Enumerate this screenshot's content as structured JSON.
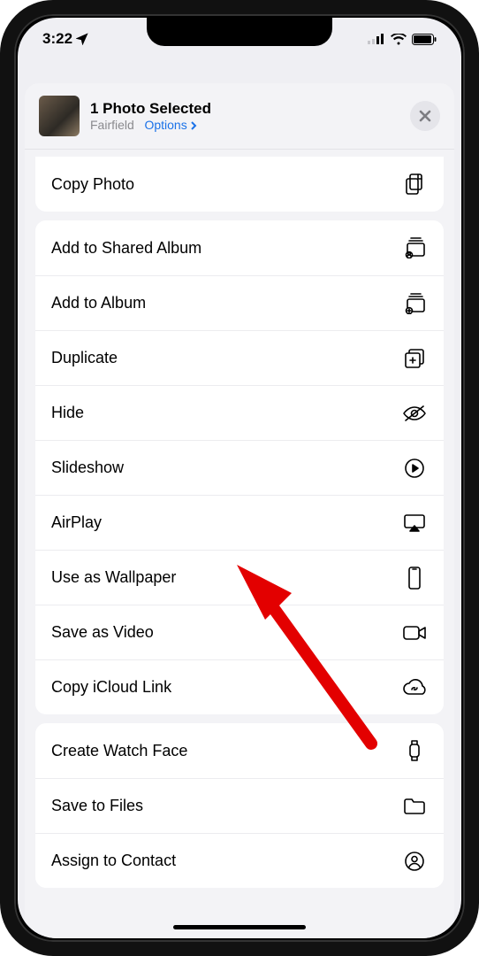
{
  "status": {
    "time": "3:22"
  },
  "header": {
    "title": "1 Photo Selected",
    "location": "Fairfield",
    "options_label": "Options"
  },
  "groups": [
    {
      "rows": [
        {
          "name": "copy-photo",
          "label": "Copy Photo",
          "icon": "doc-on-doc"
        }
      ]
    },
    {
      "rows": [
        {
          "name": "add-shared-album",
          "label": "Add to Shared Album",
          "icon": "shared-album"
        },
        {
          "name": "add-album",
          "label": "Add to Album",
          "icon": "add-album"
        },
        {
          "name": "duplicate",
          "label": "Duplicate",
          "icon": "plus-square-on-square"
        },
        {
          "name": "hide",
          "label": "Hide",
          "icon": "eye-slash"
        },
        {
          "name": "slideshow",
          "label": "Slideshow",
          "icon": "play-circle"
        },
        {
          "name": "airplay",
          "label": "AirPlay",
          "icon": "airplay"
        },
        {
          "name": "use-wallpaper",
          "label": "Use as Wallpaper",
          "icon": "iphone"
        },
        {
          "name": "save-video",
          "label": "Save as Video",
          "icon": "video"
        },
        {
          "name": "copy-icloud",
          "label": "Copy iCloud Link",
          "icon": "link-cloud"
        }
      ]
    },
    {
      "rows": [
        {
          "name": "create-watch-face",
          "label": "Create Watch Face",
          "icon": "watch"
        },
        {
          "name": "save-files",
          "label": "Save to Files",
          "icon": "folder"
        },
        {
          "name": "assign-contact",
          "label": "Assign to Contact",
          "icon": "person-circle"
        }
      ]
    }
  ],
  "arrow_target": "use-wallpaper"
}
